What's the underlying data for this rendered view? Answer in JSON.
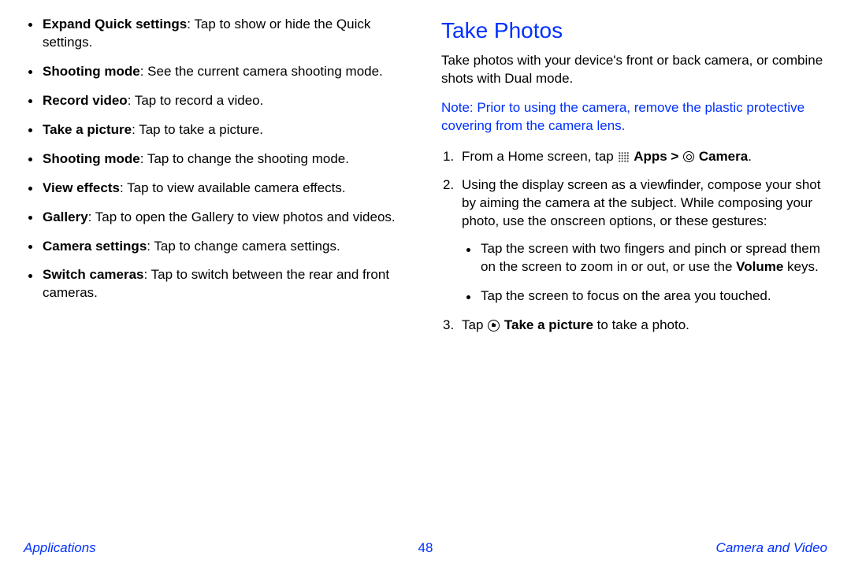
{
  "left": {
    "bullets": [
      {
        "term": "Expand Quick settings",
        "desc": ": Tap to show or hide the Quick settings."
      },
      {
        "term": "Shooting mode",
        "desc": ": See the current camera shooting mode."
      },
      {
        "term": "Record video",
        "desc": ": Tap to record a video."
      },
      {
        "term": "Take a picture",
        "desc": ": Tap to take a picture."
      },
      {
        "term": "Shooting mode",
        "desc": ": Tap to change the shooting mode."
      },
      {
        "term": "View effects",
        "desc": ": Tap to view available camera effects."
      },
      {
        "term": "Gallery",
        "desc": ": Tap to open the Gallery to view photos and videos."
      },
      {
        "term": "Camera settings",
        "desc": ": Tap to change camera settings."
      },
      {
        "term": "Switch cameras",
        "desc": ": Tap to switch between the rear and front cameras."
      }
    ]
  },
  "right": {
    "heading": "Take Photos",
    "intro": "Take photos with your device's front or back camera, or combine shots with Dual mode.",
    "note_prefix": "Note",
    "note_body": ": Prior to using the camera, remove the plastic protective covering from the camera lens.",
    "step1_pre": "From a Home screen, tap ",
    "step1_apps": "Apps > ",
    "step1_camera": "Camera",
    "step1_post": ".",
    "step2_lead": "Using the display screen as a viewfinder, compose your shot by aiming the camera at the subject. While composing your photo, use the onscreen options, or these gestures:",
    "step2_b1_pre": "Tap the screen with two fingers and pinch or spread them on the screen to zoom in or out, or use the ",
    "step2_b1_bold": "Volume",
    "step2_b1_post": " keys.",
    "step2_b2": "Tap the screen to focus on the area you touched.",
    "step3_pre": "Tap ",
    "step3_bold": "Take a picture",
    "step3_post": " to take a photo."
  },
  "footer": {
    "left": "Applications",
    "page": "48",
    "right": "Camera and Video"
  }
}
